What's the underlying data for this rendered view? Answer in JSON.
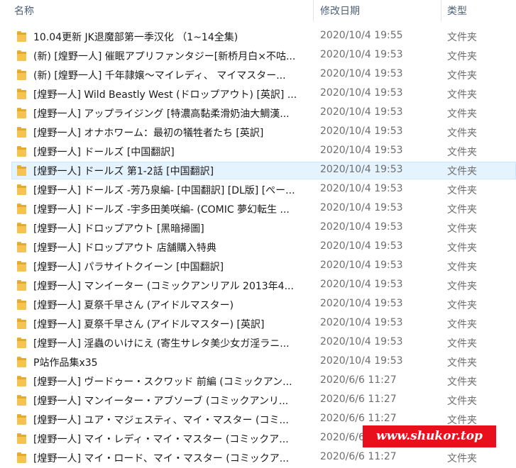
{
  "columns": {
    "name": "名称",
    "date": "修改日期",
    "type": "类型"
  },
  "rows": [
    {
      "name": "10.04更新 JK退魔部第一季汉化 （1~14全集)",
      "date": "2020/10/4 19:55",
      "type": "文件夹"
    },
    {
      "name": "(新) [煌野一人] 催眠アプリファンタジー[新桥月白×不咕...",
      "date": "2020/10/4 19:53",
      "type": "文件夹"
    },
    {
      "name": "(新) [煌野一人] 千年隷嬢～マイレディ、 マイマスター...",
      "date": "2020/10/4 19:53",
      "type": "文件夹"
    },
    {
      "name": "[煌野一人] Wild Beastly West (ドロップアウト) [英訳] ...",
      "date": "2020/10/4 19:53",
      "type": "文件夹"
    },
    {
      "name": "[煌野一人] アップライジング [特濃高黏柔滑奶油大鯛漢...",
      "date": "2020/10/4 19:53",
      "type": "文件夹"
    },
    {
      "name": "[煌野一人] オナホワーム：最初の犠牲者たち [英訳]",
      "date": "2020/10/4 19:53",
      "type": "文件夹"
    },
    {
      "name": "[煌野一人] ドールズ [中国翻訳]",
      "date": "2020/10/4 19:53",
      "type": "文件夹"
    },
    {
      "name": "[煌野一人] ドールズ 第1-2話 [中国翻訳]",
      "date": "2020/10/4 19:53",
      "type": "文件夹",
      "selected": true
    },
    {
      "name": "[煌野一人] ドールズ -芳乃泉編- [中国翻訳] [DL版] [ぺー...",
      "date": "2020/10/4 19:53",
      "type": "文件夹"
    },
    {
      "name": "[煌野一人] ドールズ -宇多田美咲編- (COMIC 夢幻転生 ...",
      "date": "2020/10/4 19:53",
      "type": "文件夹"
    },
    {
      "name": "[煌野一人] ドロップアウト [黑暗掃圖]",
      "date": "2020/10/4 19:53",
      "type": "文件夹"
    },
    {
      "name": "[煌野一人] ドロップアウト 店舗購入特典",
      "date": "2020/10/4 19:53",
      "type": "文件夹"
    },
    {
      "name": "[煌野一人] パラサイトクイーン [中国翻訳]",
      "date": "2020/10/4 19:53",
      "type": "文件夹"
    },
    {
      "name": "[煌野一人] マンイーター (コミックアンリアル 2013年4...",
      "date": "2020/10/4 19:53",
      "type": "文件夹"
    },
    {
      "name": "[煌野一人] 夏祭千早さん (アイドルマスター)",
      "date": "2020/10/4 19:53",
      "type": "文件夹"
    },
    {
      "name": "[煌野一人] 夏祭千早さん (アイドルマスター) [英訳]",
      "date": "2020/10/4 19:53",
      "type": "文件夹"
    },
    {
      "name": "[煌野一人] 淫蟲のいけにえ (寄生サレタ美少女ガ淫ラニ...",
      "date": "2020/10/4 19:53",
      "type": "文件夹"
    },
    {
      "name": "P站作品集x35",
      "date": "2020/10/4 19:53",
      "type": "文件夹"
    },
    {
      "name": "[煌野一人] ヴードゥー・スクワッド 前編 (コミックアン...",
      "date": "2020/6/6 11:27",
      "type": "文件夹"
    },
    {
      "name": "[煌野一人] マンイーター・アブソーブ (コミックアンリ...",
      "date": "2020/6/6 11:27",
      "type": "文件夹"
    },
    {
      "name": "[煌野一人] ユア・マジェスティ、マイ・マスター (コミ...",
      "date": "2020/6/6 11:27",
      "type": "文件夹"
    },
    {
      "name": "[煌野一人] マイ・レディ・マイ・マスター (コミックア...",
      "date": "2020/6/6 11:27",
      "type": "文件夹"
    },
    {
      "name": "[煌野一人] マイ・ロード、マイ・マスター (コミックア...",
      "date": "2020/6/6 11:27",
      "type": "文件夹"
    }
  ],
  "watermark": "www.shukor.top",
  "colors": {
    "folder": "#f5c34f",
    "selection": "#e5f3ff",
    "watermark_bg": "#e8101d",
    "header_text": "#4c607a"
  }
}
